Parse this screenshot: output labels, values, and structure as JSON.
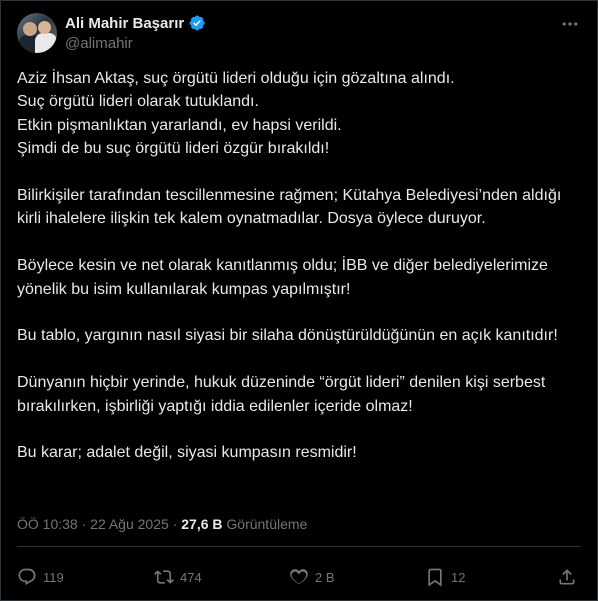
{
  "author": {
    "display_name": "Ali Mahir Başarır",
    "handle": "@alimahir",
    "verified": true,
    "avatar_icon": "profile-photo-avatar"
  },
  "tweet": {
    "paragraphs": [
      [
        "Aziz İhsan Aktaş, suç örgütü lideri olduğu için gözaltına alındı.",
        "Suç örgütü lideri olarak tutuklandı.",
        "Etkin pişmanlıktan yararlandı, ev hapsi verildi.",
        "Şimdi de bu suç örgütü lideri özgür bırakıldı!"
      ],
      [
        "Bilirkişiler tarafından tescillenmesine rağmen; Kütahya Belediyesi’nden aldığı kirli ihalelere ilişkin tek kalem oynatmadılar. Dosya öylece duruyor."
      ],
      [
        "Böylece kesin ve net olarak kanıtlanmış oldu; İBB ve diğer belediyelerimize yönelik bu isim kullanılarak kumpas yapılmıştır!"
      ],
      [
        "Bu tablo, yargının nasıl siyasi bir silaha dönüştürüldüğünün en açık kanıtıdır!"
      ],
      [
        "Dünyanın hiçbir yerinde, hukuk düzeninde “örgüt lideri” denilen kişi serbest bırakılırken, işbirliği yaptığı iddia edilenler içeride olmaz!"
      ],
      [
        "Bu karar; adalet değil, siyasi kumpasın resmidir!"
      ]
    ]
  },
  "meta": {
    "time": "ÖÖ 10:38",
    "separator": "·",
    "date": "22 Ağu 2025",
    "views_count": "27,6 B",
    "views_label": "Görüntüleme"
  },
  "actions": {
    "reply_count": "119",
    "repost_count": "474",
    "like_count": "2 B",
    "bookmark_count": "12"
  },
  "colors": {
    "background": "#000000",
    "text": "#e7e9ea",
    "secondary": "#71767b",
    "verified": "#1d9bf0",
    "border": "#2f3336"
  }
}
